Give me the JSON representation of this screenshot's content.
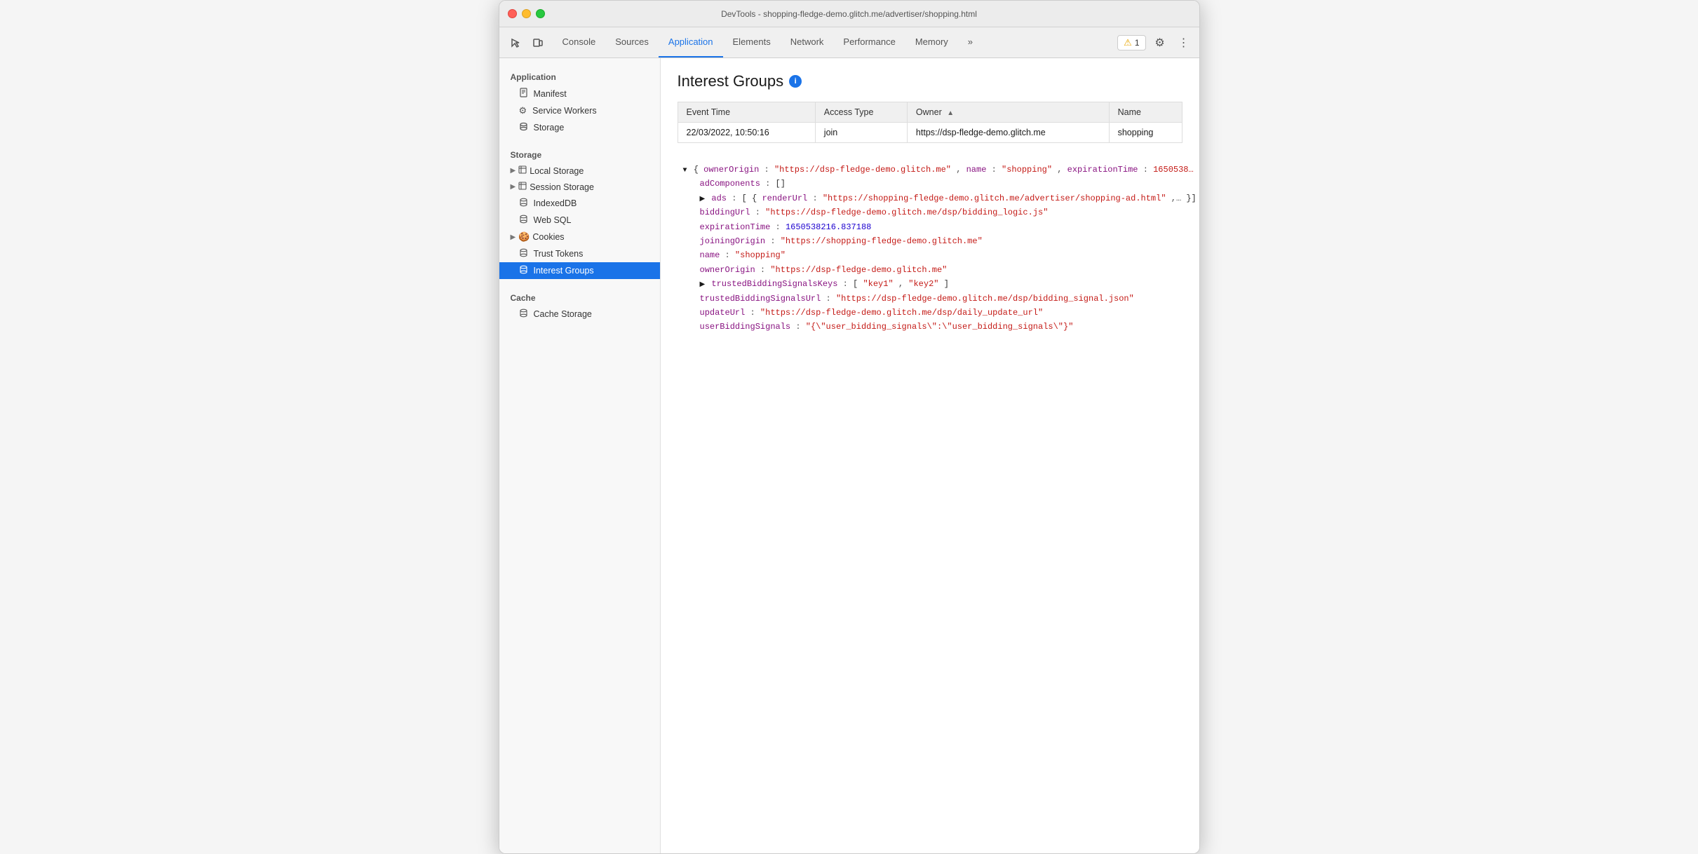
{
  "window": {
    "title": "DevTools - shopping-fledge-demo.glitch.me/advertiser/shopping.html"
  },
  "toolbar": {
    "tabs": [
      {
        "id": "console",
        "label": "Console",
        "active": false
      },
      {
        "id": "sources",
        "label": "Sources",
        "active": false
      },
      {
        "id": "application",
        "label": "Application",
        "active": true
      },
      {
        "id": "elements",
        "label": "Elements",
        "active": false
      },
      {
        "id": "network",
        "label": "Network",
        "active": false
      },
      {
        "id": "performance",
        "label": "Performance",
        "active": false
      },
      {
        "id": "memory",
        "label": "Memory",
        "active": false
      }
    ],
    "warn_count": "1",
    "more_tabs_label": "»"
  },
  "sidebar": {
    "application_section": "Application",
    "application_items": [
      {
        "id": "manifest",
        "label": "Manifest",
        "icon": "📄"
      },
      {
        "id": "service-workers",
        "label": "Service Workers",
        "icon": "⚙️"
      },
      {
        "id": "storage",
        "label": "Storage",
        "icon": "🗄️"
      }
    ],
    "storage_section": "Storage",
    "storage_items": [
      {
        "id": "local-storage",
        "label": "Local Storage",
        "icon": "▦",
        "expandable": true
      },
      {
        "id": "session-storage",
        "label": "Session Storage",
        "icon": "▦",
        "expandable": true
      },
      {
        "id": "indexeddb",
        "label": "IndexedDB",
        "icon": "🗄️"
      },
      {
        "id": "web-sql",
        "label": "Web SQL",
        "icon": "🗄️"
      },
      {
        "id": "cookies",
        "label": "Cookies",
        "icon": "🍪",
        "expandable": true
      },
      {
        "id": "trust-tokens",
        "label": "Trust Tokens",
        "icon": "🗄️"
      },
      {
        "id": "interest-groups",
        "label": "Interest Groups",
        "icon": "🗄️",
        "active": true
      }
    ],
    "cache_section": "Cache",
    "cache_items": [
      {
        "id": "cache-storage",
        "label": "Cache Storage",
        "icon": "🗄️"
      }
    ]
  },
  "main": {
    "page_title": "Interest Groups",
    "table": {
      "headers": [
        {
          "id": "event_time",
          "label": "Event Time",
          "sorted": false
        },
        {
          "id": "access_type",
          "label": "Access Type",
          "sorted": false
        },
        {
          "id": "owner",
          "label": "Owner",
          "sorted": true,
          "sort_dir": "asc"
        },
        {
          "id": "name",
          "label": "Name",
          "sorted": false
        }
      ],
      "rows": [
        {
          "event_time": "22/03/2022, 10:50:16",
          "access_type": "join",
          "owner": "https://dsp-fledge-demo.glitch.me",
          "name": "shopping"
        }
      ]
    },
    "json_tree": {
      "top_line": "{ownerOrigin: \"https://dsp-fledge-demo.glitch.me\", name: \"shopping\", expirationTime: 1650538…",
      "lines": [
        {
          "indent": 1,
          "key": "adComponents",
          "value": "[]",
          "type": "bracket",
          "collapsed": false
        },
        {
          "indent": 1,
          "key": "ads",
          "value": "[{renderUrl: \"https://shopping-fledge-demo.glitch.me/advertiser/shopping-ad.html\",…}]",
          "type": "expandable",
          "collapsed": true
        },
        {
          "indent": 1,
          "key": "biddingUrl",
          "value": "\"https://dsp-fledge-demo.glitch.me/dsp/bidding_logic.js\"",
          "type": "string"
        },
        {
          "indent": 1,
          "key": "expirationTime",
          "value": "1650538216.837188",
          "type": "number"
        },
        {
          "indent": 1,
          "key": "joiningOrigin",
          "value": "\"https://shopping-fledge-demo.glitch.me\"",
          "type": "string"
        },
        {
          "indent": 1,
          "key": "name",
          "value": "\"shopping\"",
          "type": "string"
        },
        {
          "indent": 1,
          "key": "ownerOrigin",
          "value": "\"https://dsp-fledge-demo.glitch.me\"",
          "type": "string"
        },
        {
          "indent": 1,
          "key": "trustedBiddingSignalsKeys",
          "value": "[\"key1\", \"key2\"]",
          "type": "expandable",
          "collapsed": true
        },
        {
          "indent": 1,
          "key": "trustedBiddingSignalsUrl",
          "value": "\"https://dsp-fledge-demo.glitch.me/dsp/bidding_signal.json\"",
          "type": "string"
        },
        {
          "indent": 1,
          "key": "updateUrl",
          "value": "\"https://dsp-fledge-demo.glitch.me/dsp/daily_update_url\"",
          "type": "string"
        },
        {
          "indent": 1,
          "key": "userBiddingSignals",
          "value": "\"{\\\"user_bidding_signals\\\":\\\"user_bidding_signals\\\"}\"",
          "type": "string"
        }
      ]
    }
  }
}
